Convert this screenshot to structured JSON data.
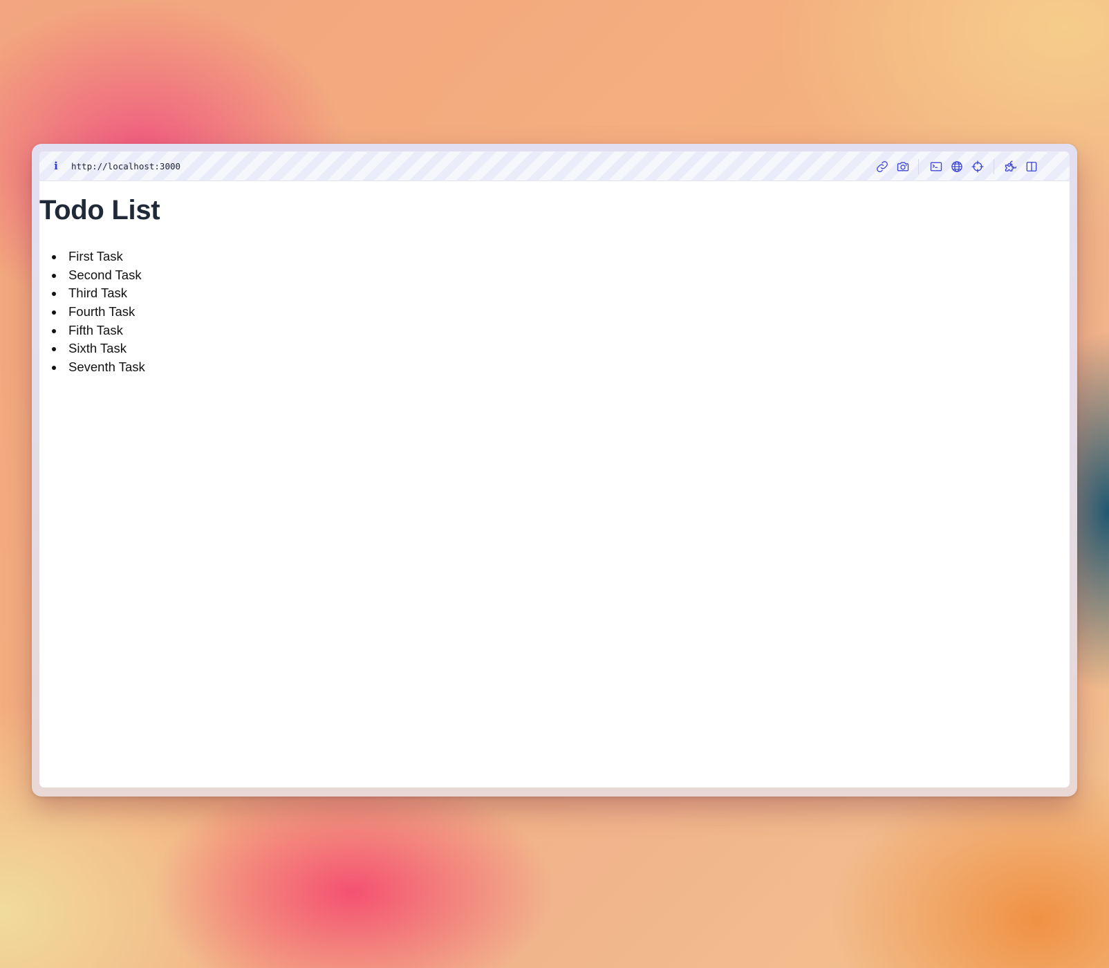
{
  "browser": {
    "info_icon": "info-icon",
    "url": "http://localhost:3000",
    "accent_color": "#3d46d6",
    "toolbar_icons": [
      "link-icon",
      "camera-icon",
      "terminal-icon",
      "globe-icon",
      "crosshair-icon",
      "extension-icon",
      "split-view-icon"
    ]
  },
  "page": {
    "title": "Todo List",
    "title_color": "#1f2937",
    "todos": [
      "First Task",
      "Second Task",
      "Third Task",
      "Fourth Task",
      "Fifth Task",
      "Sixth Task",
      "Seventh Task"
    ]
  }
}
